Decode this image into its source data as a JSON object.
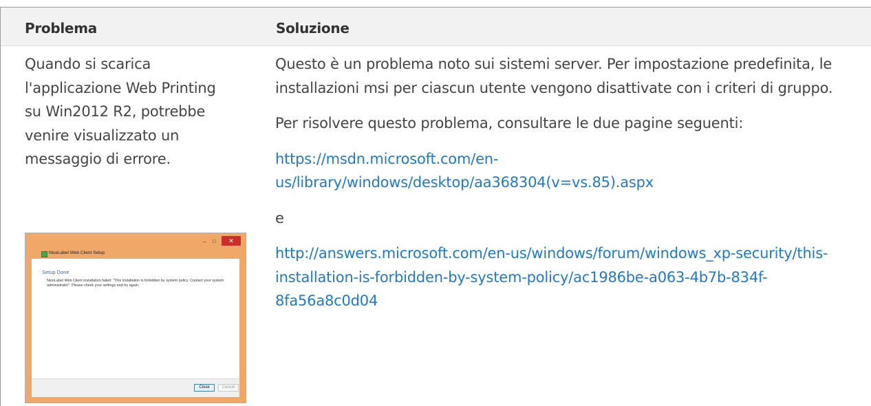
{
  "table": {
    "header": {
      "problem": "Problema",
      "solution": "Soluzione"
    },
    "row": {
      "problem_text": "Quando si scarica l'applicazione Web Printing su Win2012 R2, potrebbe venire visualizzato un messaggio di errore.",
      "solution": {
        "para1": "Questo è un problema noto sui sistemi server. Per impostazione predefinita, le installazioni msi per ciascun utente vengono disattivate con i criteri di gruppo.",
        "para2": "Per risolvere questo problema, consultare le due pagine seguenti:",
        "link1": "https://msdn.microsoft.com/en-us/library/windows/desktop/aa368304(v=vs.85).aspx",
        "conjunction": "e",
        "link2": "http://answers.microsoft.com/en-us/windows/forum/windows_xp-security/this-installation-is-forbidden-by-system-policy/ac1986be-a063-4b7b-834f-8fa56a8c0d04"
      }
    }
  },
  "screenshot": {
    "window_title": "NiceLabel Web Client Setup",
    "minimize_glyph": "–",
    "maximize_glyph": "□",
    "close_glyph": "✕",
    "heading": "Setup Done",
    "message": "NiceLabel Web Client installation failed: \"This installation is forbidden by system policy. Contact your system administrator\". Please check your settings and try again.",
    "close_button": "Close",
    "cancel_button": "Cancel"
  },
  "colors": {
    "link": "#1f7ac6",
    "header_bg": "#f2f2f2",
    "window_frame": "#f0a868",
    "window_close": "#c9302c"
  }
}
